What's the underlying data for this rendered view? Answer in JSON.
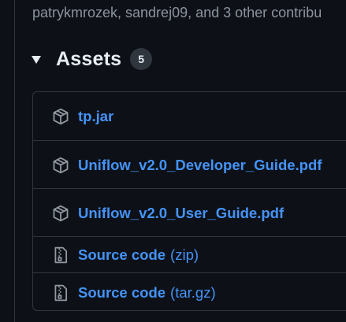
{
  "release": {
    "contributors_text": "patrykmrozek, sandrej09, and 3 other contribu"
  },
  "assets": {
    "title": "Assets",
    "count": "5",
    "items": [
      {
        "name": "tp.jar",
        "suffix": "",
        "icon": "package-icon"
      },
      {
        "name": "Uniflow_v2.0_Developer_Guide.pdf",
        "suffix": "",
        "icon": "package-icon"
      },
      {
        "name": "Uniflow_v2.0_User_Guide.pdf",
        "suffix": "",
        "icon": "package-icon"
      },
      {
        "name": "Source code",
        "suffix": "(zip)",
        "icon": "file-zip-icon"
      },
      {
        "name": "Source code",
        "suffix": "(tar.gz)",
        "icon": "file-zip-icon"
      }
    ]
  },
  "colors": {
    "background": "#0d1117",
    "link": "#4493f8",
    "border": "#30363d",
    "muted_text": "#8b949e",
    "primary_text": "#e6edf3"
  }
}
